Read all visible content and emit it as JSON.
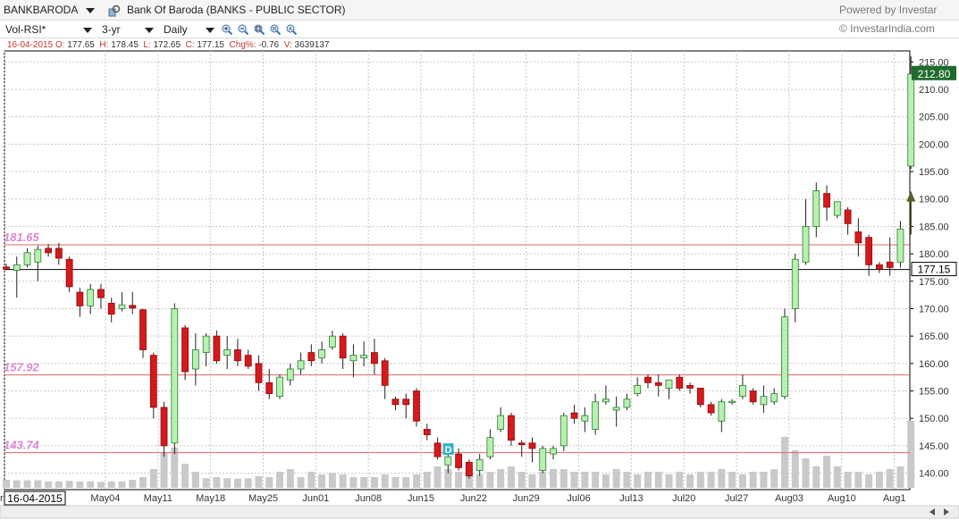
{
  "toolbar": {
    "symbol": "BANKBARODA",
    "company": "Bank Of Baroda  (BANKS - PUBLIC SECTOR)",
    "powered": "Powered by Investar",
    "indicator": "Vol-RSI*",
    "period": "3-yr",
    "interval": "Daily",
    "copyright": "© InvestarIndia.com"
  },
  "icons": [
    "dropdown-caret-icon",
    "chart-search-icon",
    "zoom-in-icon",
    "zoom-out-icon",
    "zoom-fit-icon",
    "zoom-reset-icon",
    "zoom-full-icon",
    "scroll-left-icon",
    "scroll-right-icon"
  ],
  "colors": {
    "up": "#b7f0b1",
    "up_border": "#2e7d2e",
    "down": "#d7191c",
    "level": "#e06666",
    "level_label": "#da88d4",
    "price_tag": "#1f6b2e"
  },
  "chart_data": {
    "type": "candlestick",
    "ohlc_readout": {
      "date": "16-04-2015",
      "open": "177.65",
      "high": "178.45",
      "low": "172.65",
      "close": "177.15",
      "chg_pct": "-0.76",
      "volume": "3639137"
    },
    "readout_labels": {
      "o": "O:",
      "h": "H:",
      "l": "L:",
      "c": "C:",
      "chg": "Chg%:",
      "v": "V:"
    },
    "ylim": [
      137,
      217
    ],
    "yticks": [
      "215.00",
      "210.00",
      "205.00",
      "200.00",
      "195.00",
      "190.00",
      "185.00",
      "180.00",
      "175.00",
      "170.00",
      "165.00",
      "160.00",
      "155.00",
      "150.00",
      "145.00",
      "140.00"
    ],
    "xticks": [
      "pr27",
      "May04",
      "May11",
      "May18",
      "May25",
      "Jun01",
      "Jun08",
      "Jun15",
      "Jun22",
      "Jun29",
      "Jul06",
      "Jul13",
      "Jul20",
      "Jul27",
      "Aug03",
      "Aug10",
      "Aug1"
    ],
    "cursor_date": "16-04-2015",
    "levels": [
      {
        "label": "181.65",
        "value": 181.65
      },
      {
        "label": "157.92",
        "value": 157.92
      },
      {
        "label": "143.74",
        "value": 143.74
      }
    ],
    "crosshair": {
      "label": "177.15",
      "value": 177.15
    },
    "last_price": {
      "label": "212.80",
      "value": 212.8
    },
    "marker_letter": "D",
    "candles": [
      {
        "o": 177.6,
        "h": 178.2,
        "l": 177.0,
        "c": 177.2
      },
      {
        "o": 177.0,
        "h": 179.5,
        "l": 172.0,
        "c": 178.0
      },
      {
        "o": 178.0,
        "h": 181.0,
        "l": 177.5,
        "c": 180.2
      },
      {
        "o": 178.5,
        "h": 181.5,
        "l": 175.0,
        "c": 180.8
      },
      {
        "o": 181.0,
        "h": 181.8,
        "l": 179.5,
        "c": 180.2
      },
      {
        "o": 181.0,
        "h": 182.0,
        "l": 178.0,
        "c": 179.2
      },
      {
        "o": 179.0,
        "h": 179.5,
        "l": 173.0,
        "c": 174.0
      },
      {
        "o": 173.0,
        "h": 173.8,
        "l": 168.5,
        "c": 170.5
      },
      {
        "o": 170.5,
        "h": 174.5,
        "l": 169.0,
        "c": 173.5
      },
      {
        "o": 173.5,
        "h": 174.5,
        "l": 170.0,
        "c": 172.0
      },
      {
        "o": 171.0,
        "h": 172.0,
        "l": 167.5,
        "c": 169.0
      },
      {
        "o": 170.0,
        "h": 173.0,
        "l": 169.5,
        "c": 170.7
      },
      {
        "o": 170.6,
        "h": 173.0,
        "l": 169.0,
        "c": 170.1
      },
      {
        "o": 169.8,
        "h": 170.0,
        "l": 161.0,
        "c": 162.5
      },
      {
        "o": 161.5,
        "h": 162.0,
        "l": 150.0,
        "c": 152.0
      },
      {
        "o": 152.0,
        "h": 153.0,
        "l": 143.0,
        "c": 145.0
      },
      {
        "o": 145.5,
        "h": 171.0,
        "l": 143.5,
        "c": 170.0
      },
      {
        "o": 166.5,
        "h": 167.0,
        "l": 157.0,
        "c": 158.5
      },
      {
        "o": 159.0,
        "h": 165.5,
        "l": 156.0,
        "c": 162.5
      },
      {
        "o": 162.0,
        "h": 165.5,
        "l": 159.5,
        "c": 165.0
      },
      {
        "o": 165.0,
        "h": 166.0,
        "l": 160.0,
        "c": 160.5
      },
      {
        "o": 161.5,
        "h": 165.0,
        "l": 159.0,
        "c": 162.5
      },
      {
        "o": 162.5,
        "h": 164.5,
        "l": 159.5,
        "c": 160.5
      },
      {
        "o": 161.5,
        "h": 162.5,
        "l": 159.0,
        "c": 159.5
      },
      {
        "o": 160.0,
        "h": 161.5,
        "l": 155.0,
        "c": 156.5
      },
      {
        "o": 156.5,
        "h": 159.0,
        "l": 153.5,
        "c": 154.5
      },
      {
        "o": 154.0,
        "h": 158.0,
        "l": 153.5,
        "c": 157.5
      },
      {
        "o": 157.0,
        "h": 160.0,
        "l": 156.0,
        "c": 159.0
      },
      {
        "o": 159.0,
        "h": 162.0,
        "l": 158.0,
        "c": 160.5
      },
      {
        "o": 162.0,
        "h": 163.5,
        "l": 159.5,
        "c": 160.5
      },
      {
        "o": 161.0,
        "h": 164.0,
        "l": 160.0,
        "c": 162.5
      },
      {
        "o": 163.0,
        "h": 166.0,
        "l": 162.5,
        "c": 165.0
      },
      {
        "o": 165.0,
        "h": 165.5,
        "l": 159.0,
        "c": 161.0
      },
      {
        "o": 160.5,
        "h": 163.5,
        "l": 157.5,
        "c": 161.5
      },
      {
        "o": 161.0,
        "h": 164.0,
        "l": 159.5,
        "c": 161.5
      },
      {
        "o": 162.0,
        "h": 164.5,
        "l": 158.0,
        "c": 160.0
      },
      {
        "o": 160.5,
        "h": 161.0,
        "l": 153.5,
        "c": 156.0
      },
      {
        "o": 153.5,
        "h": 154.0,
        "l": 151.5,
        "c": 152.5
      },
      {
        "o": 153.5,
        "h": 154.5,
        "l": 150.0,
        "c": 152.5
      },
      {
        "o": 155.0,
        "h": 155.5,
        "l": 148.5,
        "c": 149.5
      },
      {
        "o": 148.0,
        "h": 149.0,
        "l": 146.0,
        "c": 147.0
      },
      {
        "o": 145.5,
        "h": 146.5,
        "l": 142.5,
        "c": 143.0
      },
      {
        "o": 141.5,
        "h": 143.5,
        "l": 140.0,
        "c": 143.0
      },
      {
        "o": 143.5,
        "h": 144.5,
        "l": 140.5,
        "c": 141.0
      },
      {
        "o": 142.0,
        "h": 142.5,
        "l": 139.0,
        "c": 139.5
      },
      {
        "o": 140.5,
        "h": 143.5,
        "l": 139.5,
        "c": 142.5
      },
      {
        "o": 143.0,
        "h": 148.0,
        "l": 142.5,
        "c": 146.5
      },
      {
        "o": 148.0,
        "h": 152.0,
        "l": 147.5,
        "c": 150.5
      },
      {
        "o": 150.5,
        "h": 151.0,
        "l": 145.0,
        "c": 146.0
      },
      {
        "o": 145.5,
        "h": 146.0,
        "l": 143.0,
        "c": 145.2
      },
      {
        "o": 145.5,
        "h": 146.5,
        "l": 142.0,
        "c": 144.5
      },
      {
        "o": 140.5,
        "h": 145.0,
        "l": 140.0,
        "c": 144.5
      },
      {
        "o": 143.5,
        "h": 145.0,
        "l": 142.5,
        "c": 144.5
      },
      {
        "o": 145.0,
        "h": 151.0,
        "l": 144.0,
        "c": 150.5
      },
      {
        "o": 151.0,
        "h": 152.5,
        "l": 149.0,
        "c": 150.0
      },
      {
        "o": 149.5,
        "h": 152.0,
        "l": 147.5,
        "c": 150.5
      },
      {
        "o": 148.0,
        "h": 154.5,
        "l": 147.0,
        "c": 153.0
      },
      {
        "o": 153.0,
        "h": 156.0,
        "l": 152.5,
        "c": 153.5
      },
      {
        "o": 151.5,
        "h": 154.0,
        "l": 148.5,
        "c": 152.0
      },
      {
        "o": 152.0,
        "h": 154.5,
        "l": 151.5,
        "c": 153.5
      },
      {
        "o": 154.5,
        "h": 157.5,
        "l": 154.0,
        "c": 156.0
      },
      {
        "o": 157.5,
        "h": 158.0,
        "l": 155.5,
        "c": 156.5
      },
      {
        "o": 156.5,
        "h": 158.0,
        "l": 154.0,
        "c": 156.0
      },
      {
        "o": 155.5,
        "h": 157.0,
        "l": 153.5,
        "c": 157.0
      },
      {
        "o": 157.5,
        "h": 158.0,
        "l": 155.0,
        "c": 155.5
      },
      {
        "o": 156.0,
        "h": 156.5,
        "l": 154.5,
        "c": 155.5
      },
      {
        "o": 155.5,
        "h": 155.5,
        "l": 152.0,
        "c": 152.5
      },
      {
        "o": 152.5,
        "h": 153.0,
        "l": 150.5,
        "c": 151.0
      },
      {
        "o": 149.5,
        "h": 153.5,
        "l": 147.5,
        "c": 153.0
      },
      {
        "o": 153.0,
        "h": 153.5,
        "l": 152.5,
        "c": 153.1
      },
      {
        "o": 154.0,
        "h": 158.0,
        "l": 153.5,
        "c": 156.0
      },
      {
        "o": 155.0,
        "h": 155.5,
        "l": 152.5,
        "c": 153.0
      },
      {
        "o": 152.5,
        "h": 156.0,
        "l": 151.0,
        "c": 154.0
      },
      {
        "o": 153.0,
        "h": 155.5,
        "l": 152.5,
        "c": 154.5
      },
      {
        "o": 154.0,
        "h": 170.0,
        "l": 153.5,
        "c": 168.5
      },
      {
        "o": 170.0,
        "h": 180.0,
        "l": 167.5,
        "c": 179.0
      },
      {
        "o": 178.5,
        "h": 190.0,
        "l": 178.0,
        "c": 185.0
      },
      {
        "o": 185.0,
        "h": 193.0,
        "l": 183.0,
        "c": 191.5
      },
      {
        "o": 191.0,
        "h": 192.5,
        "l": 186.0,
        "c": 188.5
      },
      {
        "o": 187.0,
        "h": 189.5,
        "l": 186.5,
        "c": 189.5
      },
      {
        "o": 188.0,
        "h": 188.5,
        "l": 183.5,
        "c": 185.5
      },
      {
        "o": 184.0,
        "h": 186.5,
        "l": 179.5,
        "c": 182.0
      },
      {
        "o": 183.0,
        "h": 183.5,
        "l": 176.0,
        "c": 178.0
      },
      {
        "o": 178.0,
        "h": 178.5,
        "l": 176.5,
        "c": 177.2
      },
      {
        "o": 178.5,
        "h": 183.0,
        "l": 176.0,
        "c": 177.5
      },
      {
        "o": 178.5,
        "h": 186.0,
        "l": 177.5,
        "c": 184.5
      },
      {
        "o": 196.0,
        "h": 216.0,
        "l": 195.5,
        "c": 212.8
      }
    ],
    "volume_rel": [
      0.15,
      0.14,
      0.14,
      0.14,
      0.12,
      0.12,
      0.13,
      0.12,
      0.12,
      0.11,
      0.12,
      0.12,
      0.15,
      0.2,
      0.35,
      0.65,
      0.75,
      0.45,
      0.3,
      0.18,
      0.2,
      0.18,
      0.17,
      0.18,
      0.22,
      0.2,
      0.3,
      0.35,
      0.2,
      0.3,
      0.25,
      0.28,
      0.25,
      0.2,
      0.2,
      0.2,
      0.25,
      0.2,
      0.2,
      0.25,
      0.3,
      0.4,
      0.35,
      0.3,
      0.4,
      0.25,
      0.3,
      0.35,
      0.4,
      0.3,
      0.25,
      0.3,
      0.35,
      0.35,
      0.3,
      0.3,
      0.3,
      0.25,
      0.35,
      0.3,
      0.25,
      0.3,
      0.3,
      0.25,
      0.3,
      0.25,
      0.3,
      0.3,
      0.35,
      0.3,
      0.25,
      0.3,
      0.3,
      0.35,
      0.95,
      0.7,
      0.55,
      0.4,
      0.6,
      0.4,
      0.3,
      0.3,
      0.25,
      0.3,
      0.35,
      0.4,
      1.25
    ]
  }
}
